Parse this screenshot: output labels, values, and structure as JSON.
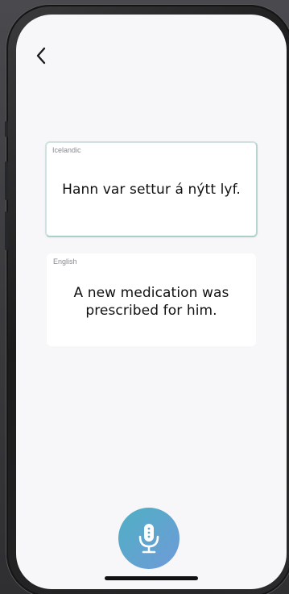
{
  "screen": {
    "back_icon": "chevron-left-icon",
    "source_card": {
      "language_label": "Icelandic",
      "sentence": "Hann var settur á nýtt lyf."
    },
    "target_card": {
      "language_label": "English",
      "sentence": "A new medication was prescribed for him."
    },
    "mic_icon": "microphone-icon"
  },
  "colors": {
    "screen_bg": "#f7f7f9",
    "card_bg": "#ffffff",
    "source_card_border": "#a9cfc8",
    "mic_gradient_start": "#4fb0c4",
    "mic_gradient_end": "#6f9ad8",
    "label_text": "#8a8a8f",
    "sentence_text": "#111113"
  }
}
